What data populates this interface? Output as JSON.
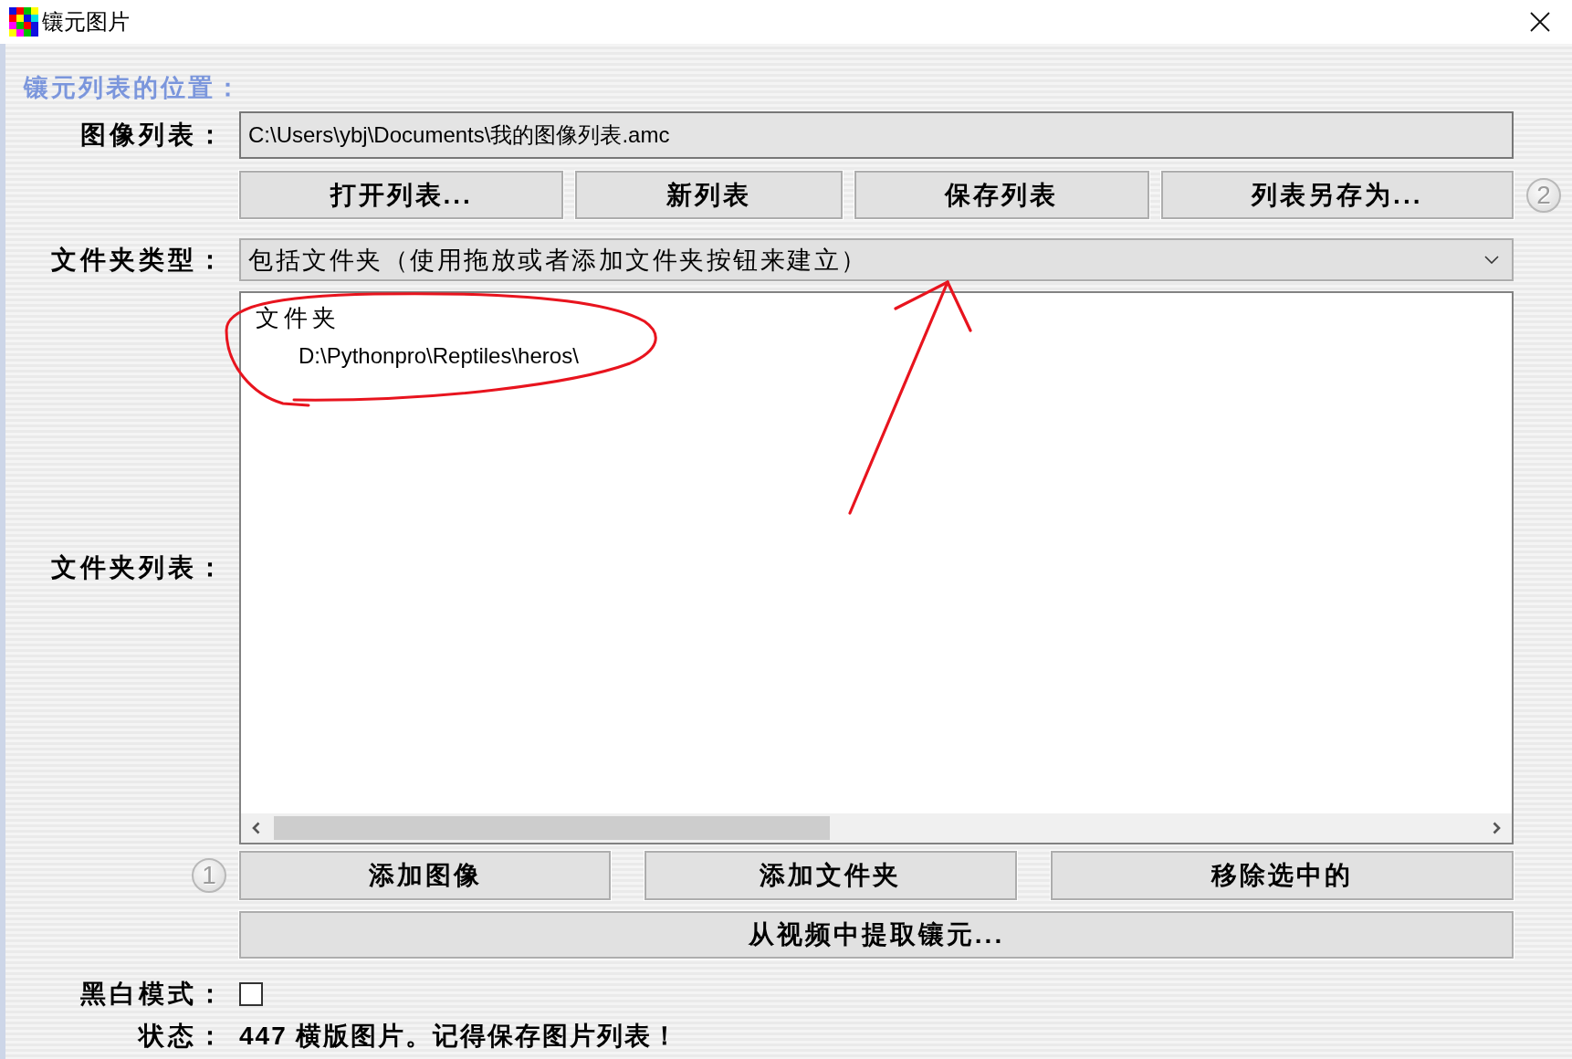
{
  "window": {
    "title": "镶元图片"
  },
  "section_title": "镶元列表的位置：",
  "image_list": {
    "label": "图像列表：",
    "value": "C:\\Users\\ybj\\Documents\\我的图像列表.amc"
  },
  "list_buttons": {
    "marker": "2",
    "buttons": [
      "打开列表...",
      "新列表",
      "保存列表",
      "列表另存为..."
    ]
  },
  "folder_type": {
    "label": "文件夹类型：",
    "value": "包括文件夹（使用拖放或者添加文件夹按钮来建立）"
  },
  "folder_list": {
    "label": "文件夹列表：",
    "tree": [
      {
        "label": "文件夹",
        "children": [
          {
            "label": "D:\\Pythonpro\\Reptiles\\heros\\"
          }
        ]
      }
    ]
  },
  "item_buttons": {
    "marker": "1",
    "buttons": [
      "添加图像",
      "添加文件夹",
      "移除选中的"
    ]
  },
  "extract_button": "从视频中提取镶元...",
  "bw_mode": {
    "label": "黑白模式：",
    "checked": false
  },
  "status": {
    "label": "状态：",
    "text": "447 横版图片。记得保存图片列表！"
  }
}
